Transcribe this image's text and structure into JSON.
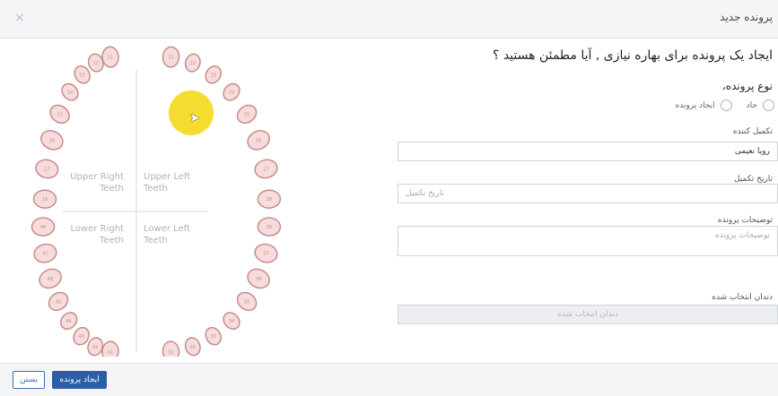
{
  "dialog": {
    "title": "پرونده جدید",
    "close_glyph": "×",
    "question": "ایجاد یک پرونده برای بهاره نیازی , آیا مطمئن هستید ؟"
  },
  "form": {
    "type_label": "نوع پرونده،",
    "type_options": [
      "جاد",
      "ایجاد پرونده"
    ],
    "completer_label": "تکمیل کننده",
    "completer_value": "رویا نعیمی",
    "date_label": "تاریخ تکمیل",
    "date_placeholder": "تاریخ تکمیل",
    "desc_label": "توضیحات پرونده",
    "desc_placeholder": "توضیحات پرونده",
    "teeth_label": "دندان انتخاب شده",
    "teeth_placeholder": "دندان انتخاب شده"
  },
  "chart": {
    "upper_right": "Upper Right\nTeeth",
    "upper_left": "Upper Left\nTeeth",
    "lower_right": "Lower Right\nTeeth",
    "lower_left": "Lower Left\nTeeth",
    "quadrant_labels": [
      "Upper Right",
      "Teeth",
      "Upper Left",
      "Teeth",
      "Lower Right",
      "Teeth",
      "Lower Left",
      "Teeth"
    ],
    "tooth_numbers_ur": [
      "11",
      "12",
      "13",
      "14",
      "15",
      "16",
      "17",
      "18"
    ],
    "tooth_numbers_ul": [
      "21",
      "22",
      "23",
      "24",
      "25",
      "26",
      "27",
      "28"
    ],
    "tooth_numbers_lr": [
      "41",
      "42",
      "43",
      "44",
      "45",
      "46",
      "47",
      "48"
    ],
    "tooth_numbers_ll": [
      "31",
      "32",
      "33",
      "34",
      "35",
      "36",
      "37",
      "38"
    ]
  },
  "footer": {
    "close_label": "بستن",
    "create_label": "ایجاد پرونده"
  }
}
